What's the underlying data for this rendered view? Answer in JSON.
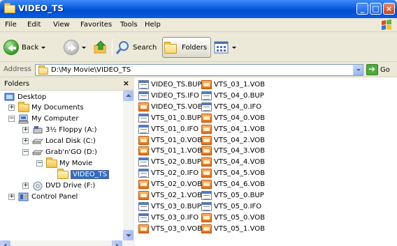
{
  "window": {
    "title": "VIDEO_TS"
  },
  "menu": [
    "File",
    "Edit",
    "View",
    "Favorites",
    "Tools",
    "Help"
  ],
  "toolbar": {
    "back_label": "Back",
    "search_label": "Search",
    "folders_label": "Folders"
  },
  "address": {
    "label": "Address",
    "value": "D:\\My Movie\\VIDEO_TS",
    "go_label": "Go"
  },
  "folders_pane": {
    "title": "Folders",
    "close": "×",
    "tree": [
      {
        "label": "Desktop"
      },
      {
        "label": "My Documents"
      },
      {
        "label": "My Computer"
      },
      {
        "label": "3½ Floppy (A:)"
      },
      {
        "label": "Local Disk (C:)"
      },
      {
        "label": "Grab'n'GO (D:)"
      },
      {
        "label": "My Movie"
      },
      {
        "label": "VIDEO_TS"
      },
      {
        "label": "DVD Drive (F:)"
      },
      {
        "label": "Control Panel"
      }
    ]
  },
  "files": {
    "col1": [
      {
        "name": "VIDEO_TS.BUP",
        "icon": "bup-file-icon"
      },
      {
        "name": "VIDEO_TS.IFO",
        "icon": "ifo-file-icon"
      },
      {
        "name": "VIDEO_TS.VOB",
        "icon": "vob-file-icon"
      },
      {
        "name": "VTS_01_0.BUP",
        "icon": "bup-file-icon"
      },
      {
        "name": "VTS_01_0.IFO",
        "icon": "ifo-file-icon"
      },
      {
        "name": "VTS_01_0.VOB",
        "icon": "vob-file-icon"
      },
      {
        "name": "VTS_01_1.VOB",
        "icon": "vob-file-icon"
      },
      {
        "name": "VTS_02_0.BUP",
        "icon": "bup-file-icon"
      },
      {
        "name": "VTS_02_0.IFO",
        "icon": "ifo-file-icon"
      },
      {
        "name": "VTS_02_0.VOB",
        "icon": "vob-file-icon"
      },
      {
        "name": "VTS_02_1.VOB",
        "icon": "vob-file-icon"
      },
      {
        "name": "VTS_03_0.BUP",
        "icon": "bup-file-icon"
      },
      {
        "name": "VTS_03_0.IFO",
        "icon": "ifo-file-icon"
      },
      {
        "name": "VTS_03_0.VOB",
        "icon": "vob-file-icon"
      }
    ],
    "col2": [
      {
        "name": "VTS_03_1.VOB",
        "icon": "vob-file-icon"
      },
      {
        "name": "VTS_04_0.BUP",
        "icon": "bup-file-icon"
      },
      {
        "name": "VTS_04_0.IFO",
        "icon": "ifo-file-icon"
      },
      {
        "name": "VTS_04_0.VOB",
        "icon": "vob-file-icon"
      },
      {
        "name": "VTS_04_1.VOB",
        "icon": "vob-file-icon"
      },
      {
        "name": "VTS_04_2.VOB",
        "icon": "vob-file-icon"
      },
      {
        "name": "VTS_04_3.VOB",
        "icon": "vob-file-icon"
      },
      {
        "name": "VTS_04_4.VOB",
        "icon": "vob-file-icon"
      },
      {
        "name": "VTS_04_5.VOB",
        "icon": "vob-file-icon"
      },
      {
        "name": "VTS_04_6.VOB",
        "icon": "vob-file-icon"
      },
      {
        "name": "VTS_05_0.BUP",
        "icon": "bup-file-icon"
      },
      {
        "name": "VTS_05_0.IFO",
        "icon": "ifo-file-icon"
      },
      {
        "name": "VTS_05_0.VOB",
        "icon": "vob-file-icon"
      },
      {
        "name": "VTS_05_1.VOB",
        "icon": "vob-file-icon"
      }
    ]
  },
  "colors": {
    "titlebar": "#0a5de0",
    "selection": "#316ac5",
    "chrome": "#ece9d8"
  }
}
